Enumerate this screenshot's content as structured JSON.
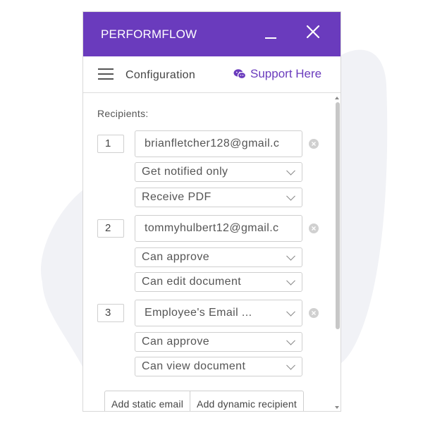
{
  "app": {
    "title": "PERFORMFLOW",
    "accent_color": "#6a3bbd"
  },
  "header": {
    "menu_icon": "hamburger-icon",
    "section_title": "Configuration",
    "support_label": "Support Here",
    "support_icon": "chat-icon"
  },
  "recipients_label": "Recipients:",
  "recipients": [
    {
      "number": "1",
      "email": "brianfletcher128@gmail.c",
      "permission": "Get notified only",
      "document_access": "Receive PDF"
    },
    {
      "number": "2",
      "email": "tommyhulbert12@gmail.c",
      "permission": "Can approve",
      "document_access": "Can edit document"
    },
    {
      "number": "3",
      "email": "Employee's Email ...",
      "permission": "Can approve",
      "document_access": "Can view document"
    }
  ],
  "actions": {
    "add_static": "Add static email",
    "add_dynamic": "Add dynamic recipient"
  }
}
